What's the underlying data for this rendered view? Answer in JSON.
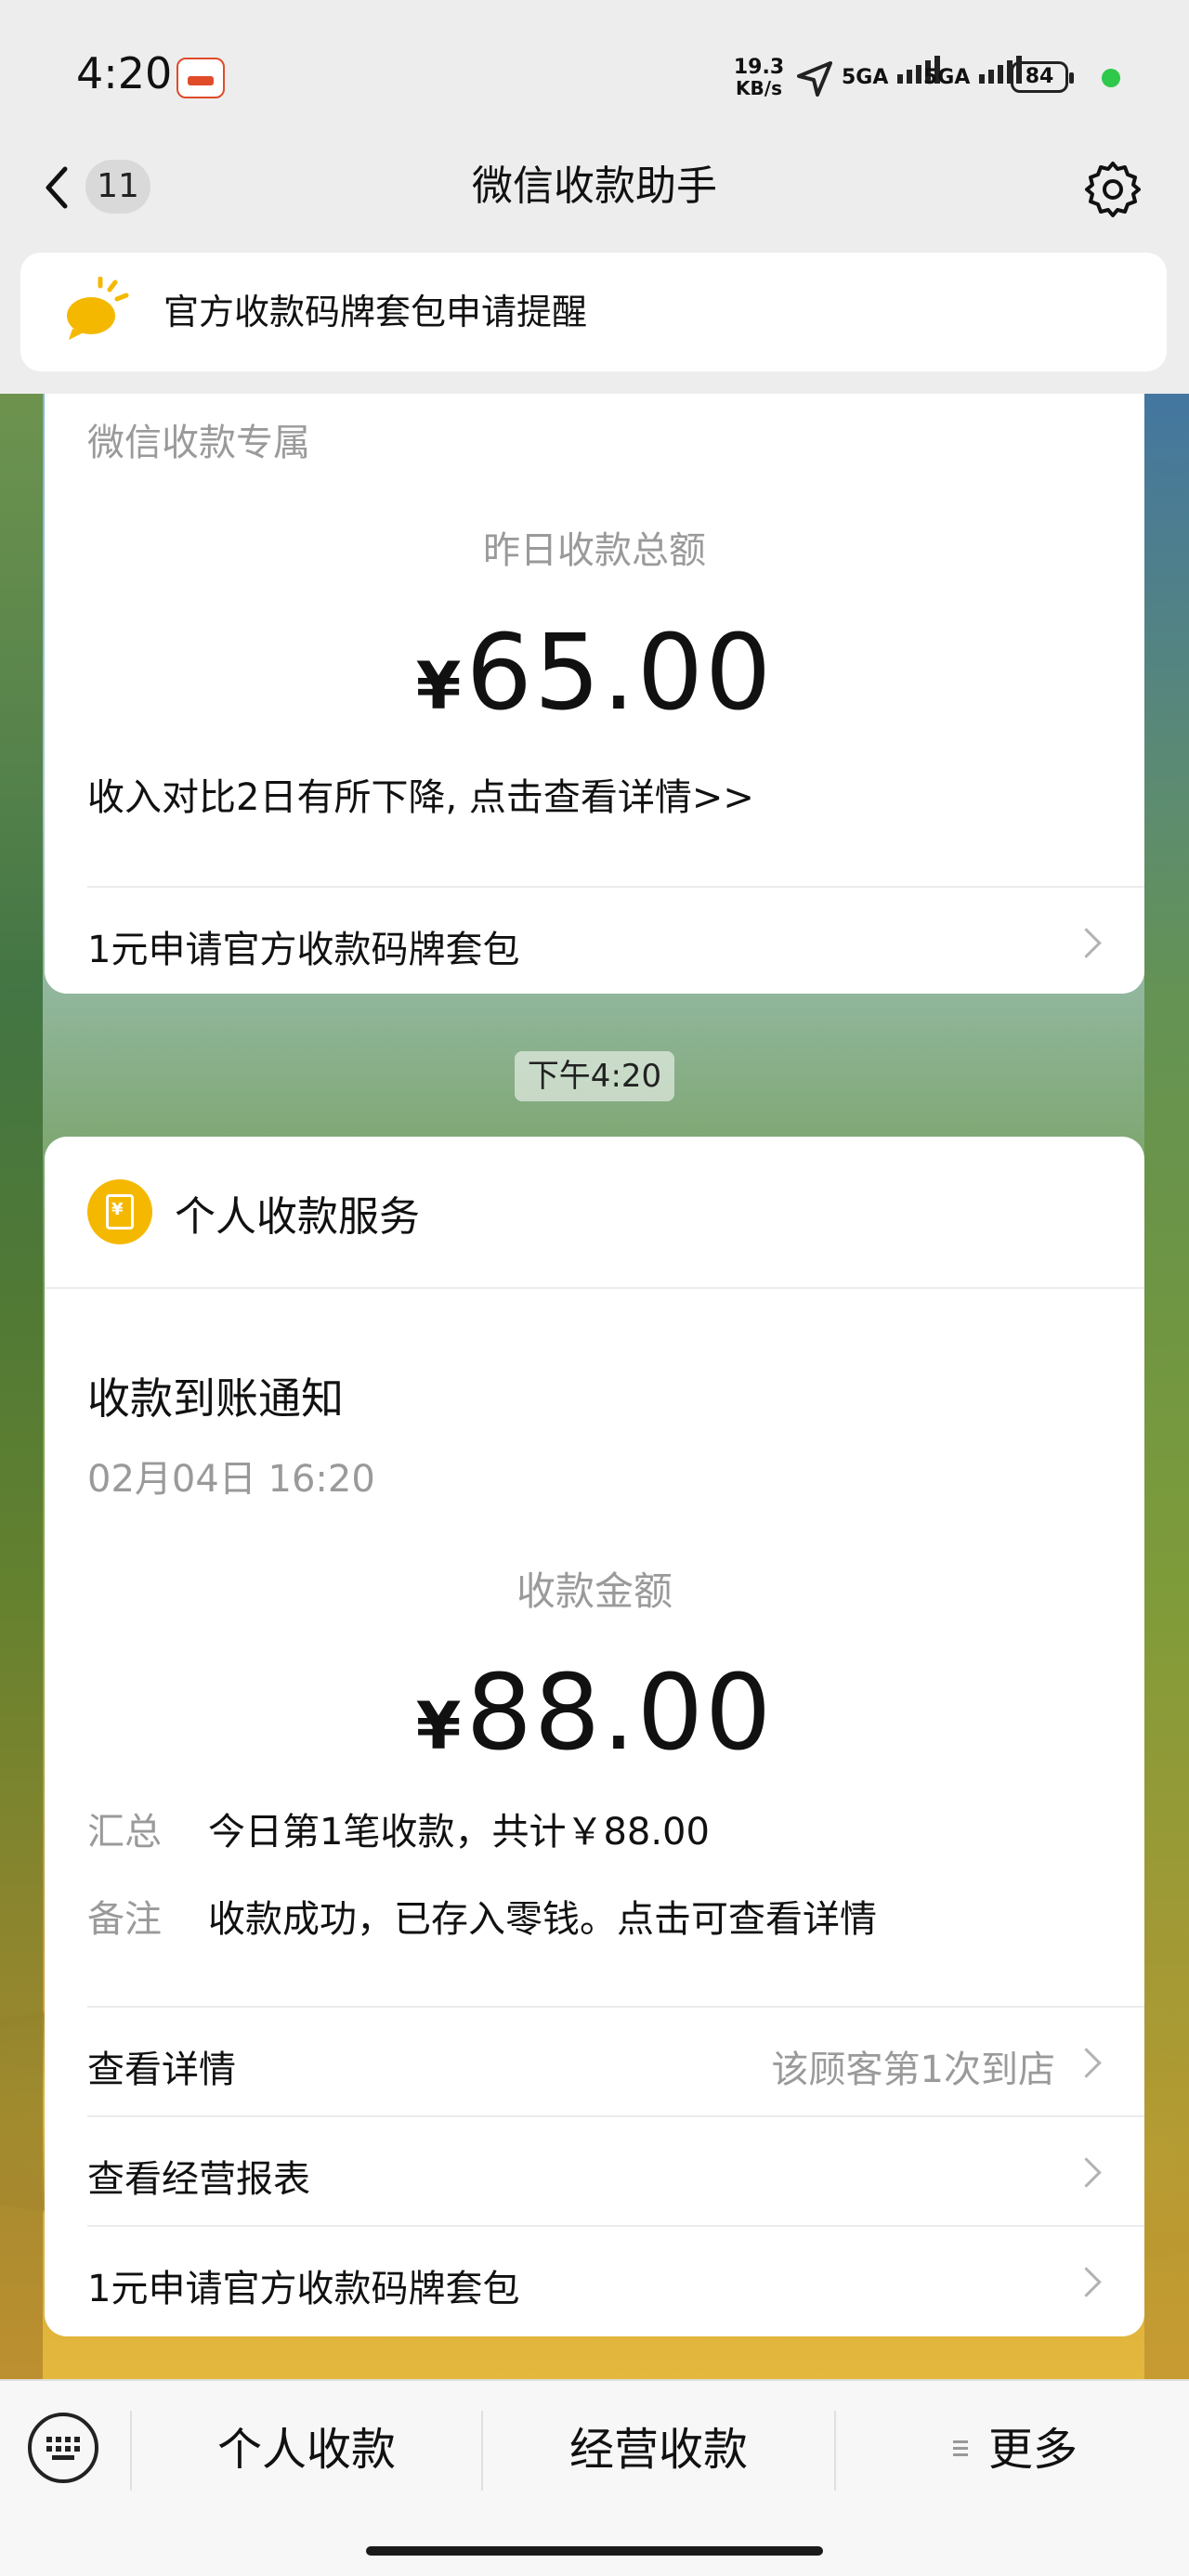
{
  "status_bar": {
    "time": "4:20",
    "net_speed_value": "19.3",
    "net_speed_unit": "KB/s",
    "signal1": "5GA",
    "signal2": "5GA",
    "battery": "84"
  },
  "nav": {
    "unread_count": "11",
    "title": "微信收款助手"
  },
  "notice": {
    "text": "官方收款码牌套包申请提醒"
  },
  "card1": {
    "header": "微信收款专属",
    "amount_label": "昨日收款总额",
    "currency": "¥",
    "amount": "65.00",
    "compare_text": "收入对比2日有所下降, 点击查看详情>>",
    "link_row": "1元申请官方收款码牌套包"
  },
  "time_chip": "下午4:20",
  "card2": {
    "service_name": "个人收款服务",
    "notice_title": "收款到账通知",
    "date": "02月04日 16:20",
    "amount_label": "收款金额",
    "currency": "¥",
    "amount": "88.00",
    "summary_label": "汇总",
    "summary_value": "今日第1笔收款，共计￥88.00",
    "remark_label": "备注",
    "remark_value": "收款成功，已存入零钱。点击可查看详情",
    "rows": [
      {
        "label": "查看详情",
        "hint": "该顾客第1次到店"
      },
      {
        "label": "查看经营报表",
        "hint": ""
      },
      {
        "label": "1元申请官方收款码牌套包",
        "hint": ""
      }
    ]
  },
  "bottom_menu": {
    "items": [
      "个人收款",
      "经营收款",
      "更多"
    ]
  },
  "colors": {
    "accent_yellow": "#f5b800",
    "status_dot": "#2ec84a"
  }
}
